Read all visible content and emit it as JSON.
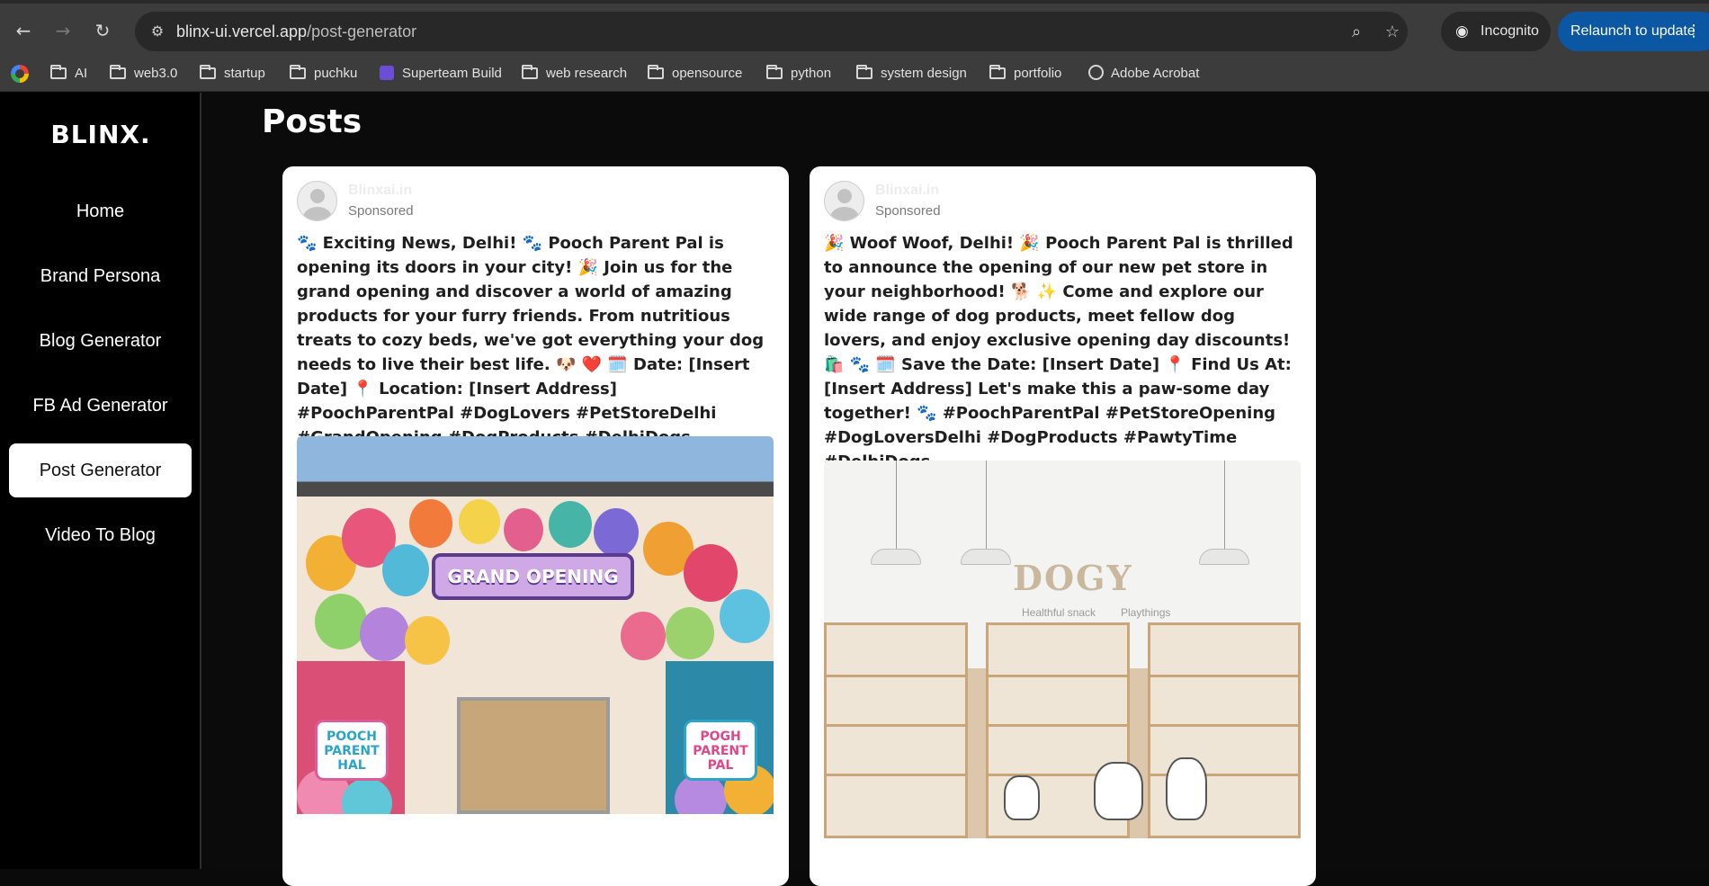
{
  "browser": {
    "url_host": "blinx-ui.vercel.app",
    "url_path": "/post-generator",
    "incognito_label": "Incognito",
    "relaunch_label": "Relaunch to update",
    "bookmarks": [
      "AI",
      "web3.0",
      "startup",
      "puchku",
      "Superteam Build",
      "web research",
      "opensource",
      "python",
      "system design",
      "portfolio",
      "Adobe Acrobat"
    ]
  },
  "sidebar": {
    "brand": "BLINX.",
    "items": [
      {
        "label": "Home",
        "active": false
      },
      {
        "label": "Brand Persona",
        "active": false
      },
      {
        "label": "Blog Generator",
        "active": false
      },
      {
        "label": "FB Ad Generator",
        "active": false
      },
      {
        "label": "Post Generator",
        "active": true
      },
      {
        "label": "Video To Blog",
        "active": false
      }
    ]
  },
  "main": {
    "title": "Posts",
    "posts": [
      {
        "author": "Blinxai.in",
        "sponsored": "Sponsored",
        "text": "🐾 Exciting News, Delhi! 🐾 Pooch Parent Pal is opening its doors in your city! 🎉 Join us for the grand opening and discover a world of amazing products for your furry friends. From nutritious treats to cozy beds, we've got everything your dog needs to live their best life. 🐶 ❤️ 🗓️ Date: [Insert Date] 📍 Location: [Insert Address] #PoochParentPal #DogLovers #PetStoreDelhi #GrandOpening #DogProducts #DelhiDogs",
        "image_sign": "GRAND OPENING",
        "image_panel_left": "POOCH PARENT HAL",
        "image_panel_right": "POGH PARENT PAL"
      },
      {
        "author": "Blinxai.in",
        "sponsored": "Sponsored",
        "text": "🎉 Woof Woof, Delhi! 🎉 Pooch Parent Pal is thrilled to announce the opening of our new pet store in your neighborhood! 🐕 ✨ Come and explore our wide range of dog products, meet fellow dog lovers, and enjoy exclusive opening day discounts! 🛍️ 🐾 🗓️ Save the Date: [Insert Date] 📍 Find Us At: [Insert Address] Let's make this a paw-some day together! 🐾 #PoochParentPal #PetStoreOpening #DogLoversDelhi #DogProducts #PawtyTime #DelhiDogs",
        "image_store": "DOGY",
        "image_sub_left": "Healthful snack",
        "image_sub_right": "Playthings"
      }
    ]
  }
}
